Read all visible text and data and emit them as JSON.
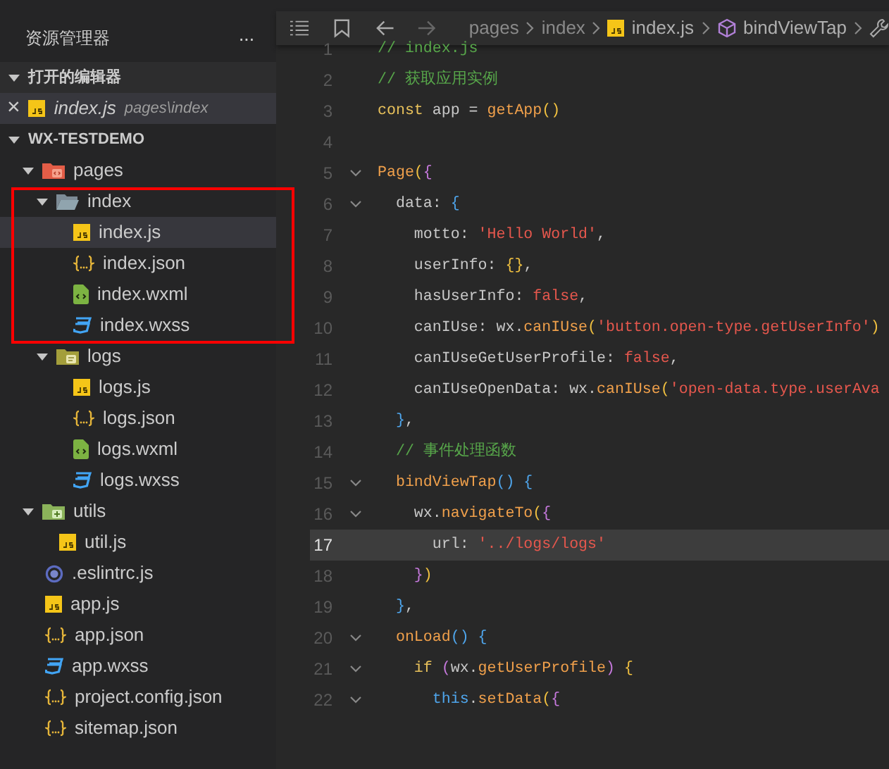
{
  "sidebar": {
    "title": "资源管理器",
    "more": "···",
    "open_editors": {
      "title": "打开的编辑器",
      "expanded": true,
      "items": [
        {
          "close": "×",
          "kind": "js",
          "name": "index.js",
          "path": "pages\\index",
          "selected": true
        }
      ]
    },
    "project": {
      "title": "WX-TESTDEMO",
      "expanded": true,
      "tree": [
        {
          "name": "pages",
          "kind": "folder-pages",
          "expanded": true,
          "selected": false,
          "children": [
            {
              "name": "index",
              "kind": "folder",
              "expanded": true,
              "selected": false,
              "children": [
                {
                  "name": "index.js",
                  "kind": "js",
                  "selected": true
                },
                {
                  "name": "index.json",
                  "kind": "json",
                  "selected": false
                },
                {
                  "name": "index.wxml",
                  "kind": "wxml",
                  "selected": false
                },
                {
                  "name": "index.wxss",
                  "kind": "wxss",
                  "selected": false
                }
              ]
            },
            {
              "name": "logs",
              "kind": "folder-logs",
              "expanded": true,
              "selected": false,
              "children": [
                {
                  "name": "logs.js",
                  "kind": "js",
                  "selected": false
                },
                {
                  "name": "logs.json",
                  "kind": "json",
                  "selected": false
                },
                {
                  "name": "logs.wxml",
                  "kind": "wxml",
                  "selected": false
                },
                {
                  "name": "logs.wxss",
                  "kind": "wxss",
                  "selected": false
                }
              ]
            }
          ]
        },
        {
          "name": "utils",
          "kind": "folder-utils",
          "expanded": true,
          "selected": false,
          "children": [
            {
              "name": "util.js",
              "kind": "js",
              "selected": false
            }
          ]
        },
        {
          "name": ".eslintrc.js",
          "kind": "eslint",
          "selected": false
        },
        {
          "name": "app.js",
          "kind": "js",
          "selected": false
        },
        {
          "name": "app.json",
          "kind": "json",
          "selected": false
        },
        {
          "name": "app.wxss",
          "kind": "wxss",
          "selected": false
        },
        {
          "name": "project.config.json",
          "kind": "json",
          "selected": false
        },
        {
          "name": "sitemap.json",
          "kind": "json",
          "selected": false
        }
      ]
    }
  },
  "breadcrumb": [
    {
      "kind": "folder",
      "text": "pages"
    },
    {
      "kind": "folder",
      "text": "index"
    },
    {
      "kind": "js",
      "text": "index.js"
    },
    {
      "kind": "method",
      "text": "bindViewTap"
    }
  ],
  "editor": {
    "lines": [
      {
        "number": "1",
        "fold": false,
        "current": false,
        "tokens": [
          {
            "text": "// index.js",
            "kind": "comment"
          }
        ]
      },
      {
        "number": "2",
        "fold": false,
        "current": false,
        "tokens": [
          {
            "text": "// 获取应用实例",
            "kind": "comment"
          }
        ]
      },
      {
        "number": "3",
        "fold": false,
        "current": false,
        "tokens": [
          {
            "text": "const",
            "kind": "keyword"
          },
          {
            "text": " app = ",
            "kind": "plain"
          },
          {
            "text": "getApp",
            "kind": "func"
          },
          {
            "text": "()",
            "kind": "b1"
          }
        ]
      },
      {
        "number": "4",
        "fold": false,
        "current": false
      },
      {
        "number": "5",
        "fold": true,
        "current": false,
        "tokens": [
          {
            "text": "Page",
            "kind": "func"
          },
          {
            "text": "(",
            "kind": "b1"
          },
          {
            "text": "{",
            "kind": "b2"
          }
        ]
      },
      {
        "number": "6",
        "fold": true,
        "current": false,
        "tokens": [
          {
            "text": "  data: ",
            "kind": "plain"
          },
          {
            "text": "{",
            "kind": "b3"
          }
        ]
      },
      {
        "number": "7",
        "fold": false,
        "current": false,
        "tokens": [
          {
            "text": "    motto: ",
            "kind": "plain"
          },
          {
            "text": "'Hello World'",
            "kind": "string"
          },
          {
            "text": ",",
            "kind": "plain"
          }
        ]
      },
      {
        "number": "8",
        "fold": false,
        "current": false,
        "tokens": [
          {
            "text": "    userInfo: ",
            "kind": "plain"
          },
          {
            "text": "{}",
            "kind": "b1"
          },
          {
            "text": ",",
            "kind": "plain"
          }
        ]
      },
      {
        "number": "9",
        "fold": false,
        "current": false,
        "tokens": [
          {
            "text": "    hasUserInfo: ",
            "kind": "plain"
          },
          {
            "text": "false",
            "kind": "string"
          },
          {
            "text": ",",
            "kind": "plain"
          }
        ]
      },
      {
        "number": "10",
        "fold": false,
        "current": false,
        "tokens": [
          {
            "text": "    canIUse: wx.",
            "kind": "plain"
          },
          {
            "text": "canIUse",
            "kind": "func"
          },
          {
            "text": "(",
            "kind": "b1"
          },
          {
            "text": "'button.open-type.getUserInfo'",
            "kind": "string"
          },
          {
            "text": ")",
            "kind": "b1"
          }
        ]
      },
      {
        "number": "11",
        "fold": false,
        "current": false,
        "tokens": [
          {
            "text": "    canIUseGetUserProfile: ",
            "kind": "plain"
          },
          {
            "text": "false",
            "kind": "string"
          },
          {
            "text": ",",
            "kind": "plain"
          }
        ]
      },
      {
        "number": "12",
        "fold": false,
        "current": false,
        "tokens": [
          {
            "text": "    canIUseOpenData: wx.",
            "kind": "plain"
          },
          {
            "text": "canIUse",
            "kind": "func"
          },
          {
            "text": "(",
            "kind": "b1"
          },
          {
            "text": "'open-data.type.userAva",
            "kind": "string"
          }
        ]
      },
      {
        "number": "13",
        "fold": false,
        "current": false,
        "tokens": [
          {
            "text": "  }",
            "kind": "b3"
          },
          {
            "text": ",",
            "kind": "plain"
          }
        ]
      },
      {
        "number": "14",
        "fold": false,
        "current": false,
        "tokens": [
          {
            "text": "  // 事件处理函数",
            "kind": "comment"
          }
        ]
      },
      {
        "number": "15",
        "fold": true,
        "current": false,
        "tokens": [
          {
            "text": "  bindViewTap",
            "kind": "func"
          },
          {
            "text": "()",
            "kind": "b3"
          },
          {
            "text": " {",
            "kind": "b3"
          }
        ]
      },
      {
        "number": "16",
        "fold": true,
        "current": false,
        "tokens": [
          {
            "text": "    wx.",
            "kind": "plain"
          },
          {
            "text": "navigateTo",
            "kind": "func"
          },
          {
            "text": "(",
            "kind": "b1"
          },
          {
            "text": "{",
            "kind": "b2"
          }
        ]
      },
      {
        "number": "17",
        "fold": false,
        "current": true,
        "tokens": [
          {
            "text": "      url: ",
            "kind": "plain"
          },
          {
            "text": "'../logs/logs'",
            "kind": "string"
          }
        ]
      },
      {
        "number": "18",
        "fold": false,
        "current": false,
        "tokens": [
          {
            "text": "    }",
            "kind": "b2"
          },
          {
            "text": ")",
            "kind": "b1"
          }
        ]
      },
      {
        "number": "19",
        "fold": false,
        "current": false,
        "tokens": [
          {
            "text": "  }",
            "kind": "b3"
          },
          {
            "text": ",",
            "kind": "plain"
          }
        ]
      },
      {
        "number": "20",
        "fold": true,
        "current": false,
        "tokens": [
          {
            "text": "  onLoad",
            "kind": "func"
          },
          {
            "text": "()",
            "kind": "b3"
          },
          {
            "text": " {",
            "kind": "b3"
          }
        ]
      },
      {
        "number": "21",
        "fold": true,
        "current": false,
        "tokens": [
          {
            "text": "    if ",
            "kind": "keyword"
          },
          {
            "text": "(",
            "kind": "b2"
          },
          {
            "text": "wx.",
            "kind": "plain"
          },
          {
            "text": "getUserProfile",
            "kind": "func"
          },
          {
            "text": ")",
            "kind": "b2"
          },
          {
            "text": " {",
            "kind": "b1"
          }
        ]
      },
      {
        "number": "22",
        "fold": true,
        "current": false,
        "tokens": [
          {
            "text": "      this",
            "kind": "this"
          },
          {
            "text": ".",
            "kind": "plain"
          },
          {
            "text": "setData",
            "kind": "func"
          },
          {
            "text": "(",
            "kind": "b1"
          },
          {
            "text": "{",
            "kind": "b2"
          }
        ]
      }
    ]
  }
}
